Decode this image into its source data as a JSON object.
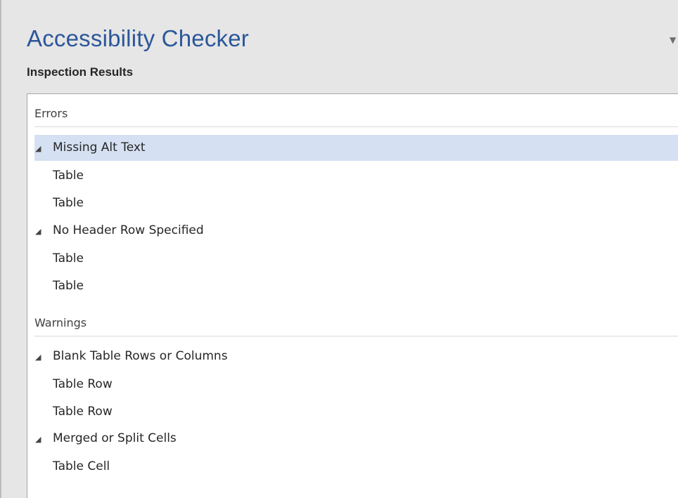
{
  "pane": {
    "title": "Accessibility Checker",
    "options_icon": "chevron-down-icon",
    "options_glyph": "▼",
    "subtitle": "Inspection Results"
  },
  "colors": {
    "title": "#2b579a",
    "pane_background": "#e6e6e6",
    "selection": "#d5e1f2"
  },
  "results": {
    "errors": {
      "label": "Errors",
      "groups": [
        {
          "caret_icon": "expanded-triangle-icon",
          "caret": "◢",
          "label": "Missing Alt Text",
          "selected": true,
          "items": [
            "Table",
            "Table"
          ]
        },
        {
          "caret_icon": "expanded-triangle-icon",
          "caret": "◢",
          "label": "No Header Row Specified",
          "selected": false,
          "items": [
            "Table",
            "Table"
          ]
        }
      ]
    },
    "warnings": {
      "label": "Warnings",
      "groups": [
        {
          "caret_icon": "expanded-triangle-icon",
          "caret": "◢",
          "label": "Blank Table Rows or Columns",
          "selected": false,
          "items": [
            "Table Row",
            "Table Row"
          ]
        },
        {
          "caret_icon": "expanded-triangle-icon",
          "caret": "◢",
          "label": "Merged or Split Cells",
          "selected": false,
          "items": [
            "Table Cell"
          ]
        }
      ]
    }
  }
}
